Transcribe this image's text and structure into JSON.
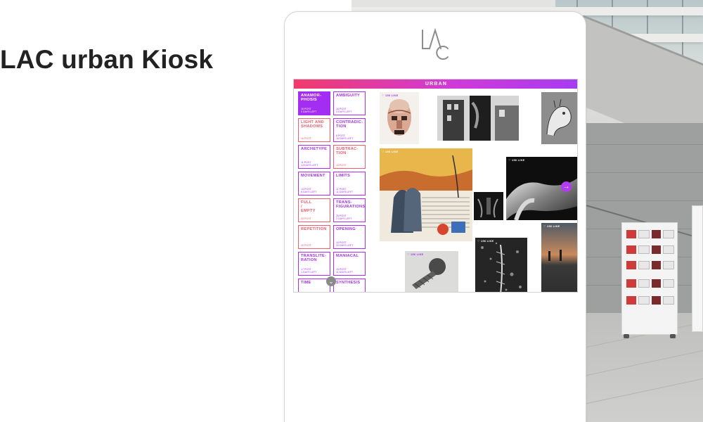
{
  "page": {
    "headline": "LAC urban Kiosk"
  },
  "kiosk": {
    "logo_icon": "lac-logo-icon",
    "screen_title": "URBAN",
    "scroll_icon": "chevron-down-icon",
    "next_icon": "arrow-right-icon",
    "colors": {
      "purple": "#a42df3",
      "coral": "#f0586a",
      "gradient_start": "#f23a6b",
      "gradient_end": "#a63cf2"
    },
    "categories": [
      {
        "title": "ANAMOR-\nPHOSIS",
        "meta": "15 POST\n3 DAYS LEFT",
        "active": true,
        "tone": "purple"
      },
      {
        "title": "AMBIGUITY",
        "meta": "16 POST\n3 DAYS LEFT",
        "active": false,
        "tone": "purple"
      },
      {
        "title": "LIGHT AND\nSHADOWS",
        "meta": "16 POST",
        "active": false,
        "tone": "coral"
      },
      {
        "title": "CONTRADIC-\nTION",
        "meta": "8 POST\n16 DAYS LEFT",
        "active": false,
        "tone": "purple"
      },
      {
        "title": "ARCHETYPE",
        "meta": "11 POST\n13 DAYS LEFT",
        "active": false,
        "tone": "purple"
      },
      {
        "title": "SUBTRAC-\nTION",
        "meta": "15 POST",
        "active": false,
        "tone": "coral"
      },
      {
        "title": "MOVEMENT",
        "meta": "13 POST\n6 DAYS LEFT",
        "active": false,
        "tone": "purple"
      },
      {
        "title": "LIMITS",
        "meta": "11 POST\n11 DAYS LEFT",
        "active": false,
        "tone": "purple"
      },
      {
        "title": "FULL\n/\nEMPTY",
        "meta": "25 POST",
        "active": false,
        "tone": "coral"
      },
      {
        "title": "TRANS-\nFIGURATIONS",
        "meta": "25 POST\n2 DAYS LEFT",
        "active": false,
        "tone": "purple"
      },
      {
        "title": "REPETITION",
        "meta": "42 POST",
        "active": false,
        "tone": "coral"
      },
      {
        "title": "OPENING",
        "meta": "10 POST\n20 DAYS LEFT",
        "active": false,
        "tone": "purple"
      },
      {
        "title": "TRANSLITE-\nRATION",
        "meta": "17 POST\n1 DAYS LEFT",
        "active": false,
        "tone": "purple"
      },
      {
        "title": "MANIACAL",
        "meta": "15 POST\n11 DAYS LEFT",
        "active": false,
        "tone": "purple"
      },
      {
        "title": "TIME",
        "meta": "",
        "active": false,
        "tone": "purple"
      },
      {
        "title": "SYNTHESIS",
        "meta": "",
        "active": false,
        "tone": "purple"
      }
    ],
    "artworks": [
      {
        "name": "artwork-mask",
        "like": "♡ 156 LIKE",
        "like_dark": true
      },
      {
        "name": "artwork-bw-building",
        "like": "",
        "like_dark": false
      },
      {
        "name": "artwork-horse-sketch",
        "like": "",
        "like_dark": false
      },
      {
        "name": "artwork-collage",
        "like": "♡ 156 LIKE",
        "like_dark": false
      },
      {
        "name": "artwork-small-dark",
        "like": "",
        "like_dark": false
      },
      {
        "name": "artwork-metal-3d",
        "like": "♡ 156 LIKE",
        "like_dark": false
      },
      {
        "name": "artwork-sphere-drawing",
        "like": "♡ 156 LIKE",
        "like_dark": true
      },
      {
        "name": "artwork-dark-texture",
        "like": "♡ 156 LIKE",
        "like_dark": false
      },
      {
        "name": "artwork-sunset-photo",
        "like": "♡ 156 LIKE",
        "like_dark": false
      }
    ]
  }
}
